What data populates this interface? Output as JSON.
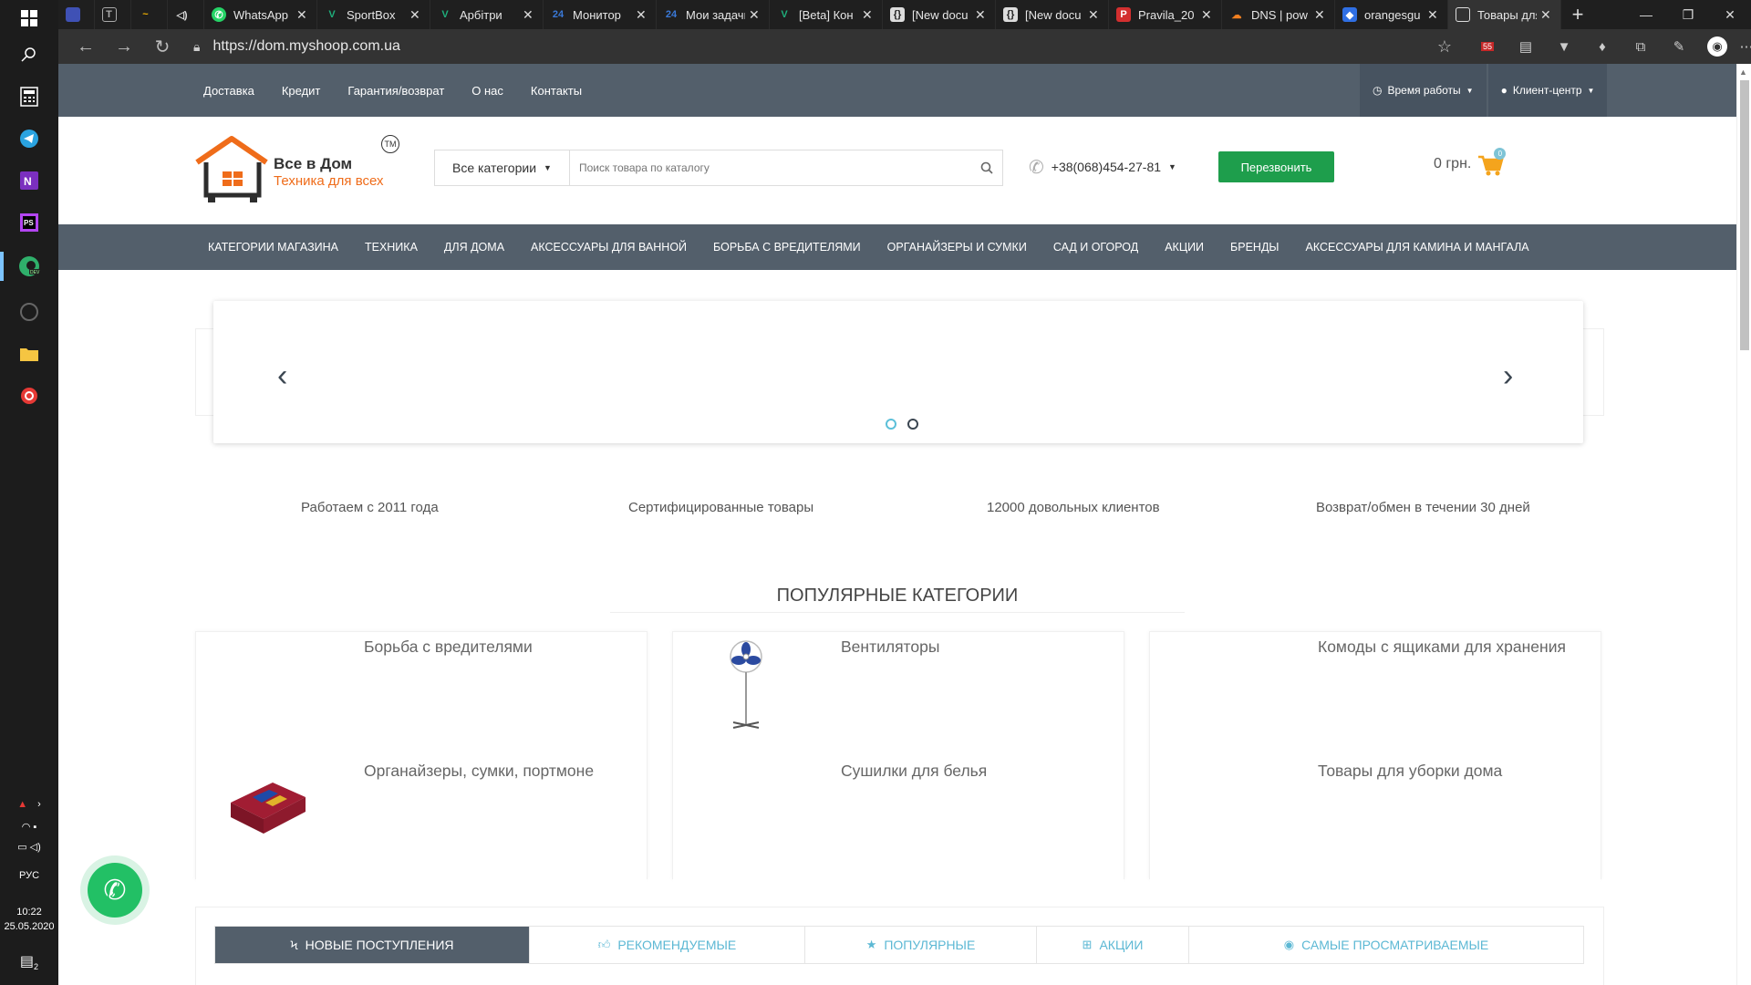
{
  "browser": {
    "tabs": [
      {
        "title": "",
        "icon": "window-icon",
        "color": "#3f51b5"
      },
      {
        "title": "",
        "icon": "text-icon",
        "color": "#777777"
      },
      {
        "title": "",
        "icon": "signal-icon",
        "color": "#f2b100"
      },
      {
        "title": "",
        "icon": "speaker-icon",
        "color": "#dddddd"
      },
      {
        "title": "WhatsApp",
        "icon": "whatsapp-icon",
        "color": "#25d366"
      },
      {
        "title": "SportBox",
        "icon": "v-icon",
        "color": "#1fae7b"
      },
      {
        "title": "Арбітри",
        "icon": "v-icon",
        "color": "#1fae7b"
      },
      {
        "title": "Монитор",
        "icon": "24-icon",
        "color": "#3a79d8"
      },
      {
        "title": "Мои задачи",
        "icon": "24-icon",
        "color": "#3a79d8"
      },
      {
        "title": "[Beta] Кон",
        "icon": "v-icon",
        "color": "#1fae7b"
      },
      {
        "title": "[New docu",
        "icon": "braces-icon",
        "color": "#dddddd"
      },
      {
        "title": "[New docu",
        "icon": "braces-icon",
        "color": "#dddddd"
      },
      {
        "title": "Pravila_20",
        "icon": "pdf-icon",
        "color": "#d32f2f"
      },
      {
        "title": "DNS | pow",
        "icon": "cloud-icon",
        "color": "#f38020"
      },
      {
        "title": "orangesgu",
        "icon": "shield-icon",
        "color": "#2f6fe4"
      },
      {
        "title": "Товары для",
        "icon": "page-icon",
        "color": "#dddddd"
      }
    ],
    "url": "https://dom.myshoop.com.ua",
    "ext_badge": "55"
  },
  "taskbar": {
    "lang": "РУС",
    "time": "10:22",
    "date": "25.05.2020",
    "notif_count": "2"
  },
  "site": {
    "top_links": [
      "Доставка",
      "Кредит",
      "Гарантия/возврат",
      "О нас",
      "Контакты"
    ],
    "work_hours": "Время работы",
    "client_center": "Клиент-центр",
    "logo": {
      "brand": "Все в Дом",
      "tagline": "Техника для всех",
      "tm": "TM"
    },
    "search": {
      "category": "Все категории",
      "placeholder": "Поиск товара по каталогу"
    },
    "phone": "+38(068)454-27-81",
    "callback_label": "Перезвонить",
    "cart": {
      "total": "0 грн.",
      "count": "0"
    },
    "catnav": [
      "Категории магазина",
      "Техника",
      "Для дома",
      "Аксессуары для ванной",
      "Борьба с вредителями",
      "Органайзеры и сумки",
      "Сад и огород",
      "Акции",
      "Бренды",
      "Аксессуары для камина и мангала"
    ],
    "usp": [
      "Работаем с 2011 года",
      "Сертифицированные товары",
      "12000 довольных клиентов",
      "Возврат/обмен в течении 30 дней"
    ],
    "popular_title": "ПОПУЛЯРНЫЕ КАТЕГОРИИ",
    "categories": [
      "Борьба с вредителями",
      "Вентиляторы",
      "Комоды с ящиками для хранения",
      "Органайзеры, сумки, портмоне",
      "Сушилки для белья",
      "Товары для уборки дома"
    ],
    "product_tabs": [
      "Новые поступления",
      "Рекомендуемые",
      "Популярные",
      "Акции",
      "Самые просматриваемые"
    ],
    "colors": {
      "nav": "#535f6b",
      "accent": "#5cb8d4",
      "green": "#1e9e4c",
      "orange": "#ef6c1a"
    }
  }
}
